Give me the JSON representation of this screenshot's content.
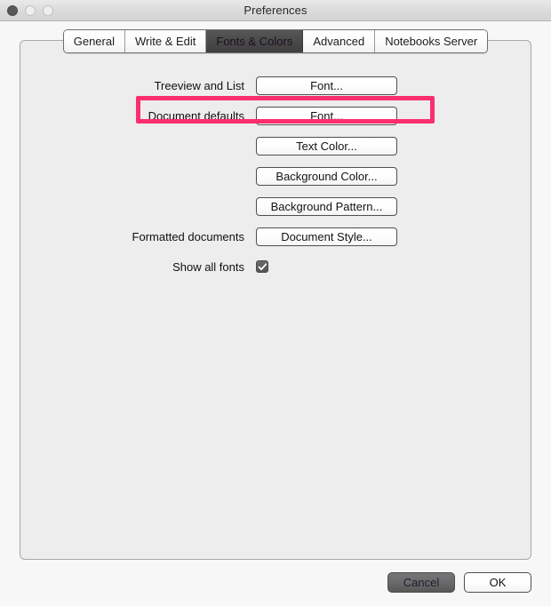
{
  "window": {
    "title": "Preferences",
    "traffic_lights": [
      {
        "name": "close",
        "label": "Close"
      },
      {
        "name": "minimize",
        "label": "Minimize"
      },
      {
        "name": "zoom",
        "label": "Zoom"
      }
    ]
  },
  "tabs": [
    {
      "label": "General",
      "selected": false
    },
    {
      "label": "Write & Edit",
      "selected": false
    },
    {
      "label": "Fonts & Colors",
      "selected": true
    },
    {
      "label": "Advanced",
      "selected": false
    },
    {
      "label": "Notebooks Server",
      "selected": false
    }
  ],
  "form": {
    "rows": [
      {
        "label": "Treeview and List",
        "control": "button",
        "button_label": "Font..."
      },
      {
        "label": "Document defaults",
        "control": "button",
        "button_label": "Font...",
        "highlighted": true
      },
      {
        "label": "",
        "control": "button",
        "button_label": "Text Color..."
      },
      {
        "label": "",
        "control": "button",
        "button_label": "Background Color..."
      },
      {
        "label": "",
        "control": "button",
        "button_label": "Background Pattern..."
      },
      {
        "label": "Formatted documents",
        "control": "button",
        "button_label": "Document Style..."
      },
      {
        "label": "Show all fonts",
        "control": "checkbox",
        "checked": true
      }
    ]
  },
  "footer": {
    "cancel_label": "Cancel",
    "ok_label": "OK"
  },
  "colors": {
    "highlight": "#fd2e6d",
    "selected_tab": "#4a4a4a",
    "panel_background": "#ededed",
    "window_background": "#f7f7f7"
  }
}
